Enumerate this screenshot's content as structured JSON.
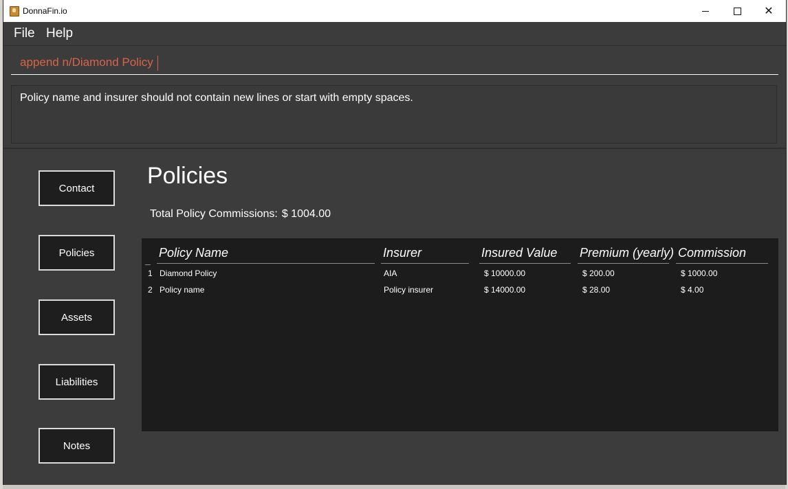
{
  "window": {
    "title": "DonnaFin.io",
    "close_glyph": "✕"
  },
  "menu": {
    "file": "File",
    "help": "Help"
  },
  "command": {
    "value": "append n/Diamond Policy"
  },
  "result": {
    "message": "Policy name and insurer should not contain new lines or start with empty spaces."
  },
  "nav": {
    "contact": "Contact",
    "policies": "Policies",
    "assets": "Assets",
    "liabilities": "Liabilities",
    "notes": "Notes"
  },
  "page": {
    "title": "Policies",
    "total_label": "Total Policy Commissions:",
    "total_value": "$ 1004.00"
  },
  "table": {
    "headers": {
      "name": "Policy Name",
      "insurer": "Insurer",
      "insured_value": "Insured Value",
      "premium": "Premium (yearly)",
      "commission": "Commission"
    },
    "rows": [
      {
        "index": "1",
        "name": "Diamond Policy",
        "insurer": "AIA",
        "insured_value": "$ 10000.00",
        "premium": "$ 200.00",
        "commission": "$ 1000.00"
      },
      {
        "index": "2",
        "name": "Policy name",
        "insurer": "Policy insurer",
        "insured_value": "$ 14000.00",
        "premium": "$ 28.00",
        "commission": "$ 4.00"
      }
    ]
  },
  "colors": {
    "background": "#3c3c3c",
    "panel": "#1c1c1c",
    "command_text": "#d9634a",
    "text": "#ffffff"
  }
}
